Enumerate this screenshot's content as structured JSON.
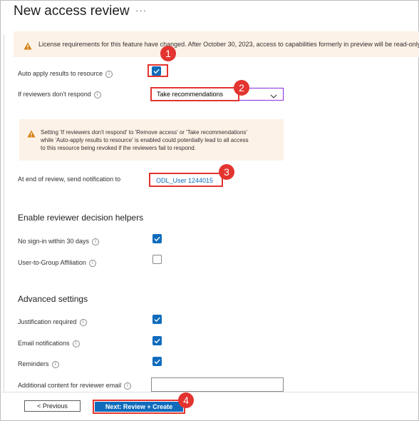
{
  "page": {
    "title": "New access review",
    "more": "···"
  },
  "banner": {
    "text": "License requirements for this feature have changed. After October 30, 2023, access to capabilities formerly in preview will be read-only."
  },
  "form": {
    "auto_apply_label": "Auto apply results to resource",
    "auto_apply_checked": true,
    "if_no_response_label": "If reviewers don't respond",
    "if_no_response_value": "Take recommendations",
    "warning_lines": [
      "Setting 'If reviewers don't respond' to 'Remove access' or 'Take recommendations'",
      "while 'Auto-apply results to resource' is enabled could potentially lead to all access",
      "to this resource being revoked if the reviewers fail to respond."
    ],
    "notify_label": "At end of review, send notification to",
    "notify_user": "ODL_User 1244015"
  },
  "helpers": {
    "heading": "Enable reviewer decision helpers",
    "items": [
      {
        "label": "No sign-in within 30 days",
        "checked": true
      },
      {
        "label": "User-to-Group Affiliation",
        "checked": false
      }
    ]
  },
  "advanced": {
    "heading": "Advanced settings",
    "items": [
      {
        "label": "Justification required",
        "checked": true
      },
      {
        "label": "Email notifications",
        "checked": true
      },
      {
        "label": "Reminders",
        "checked": true
      }
    ],
    "additional_content_label": "Additional content for reviewer email"
  },
  "footer": {
    "previous_label": "< Previous",
    "next_label": "Next: Review + Create"
  },
  "callouts": [
    "1",
    "2",
    "3",
    "4"
  ],
  "icons": {
    "info": "info-icon",
    "warning": "warning-icon",
    "chevron": "chevron-down-icon",
    "check": "checkmark-icon"
  },
  "colors": {
    "accent": "#0f6cbd",
    "callout_red": "#e3342f",
    "warning_bg": "#fdf2e7",
    "warning_icon": "#d47f0f",
    "dropdown_focus": "#8a2be2"
  }
}
